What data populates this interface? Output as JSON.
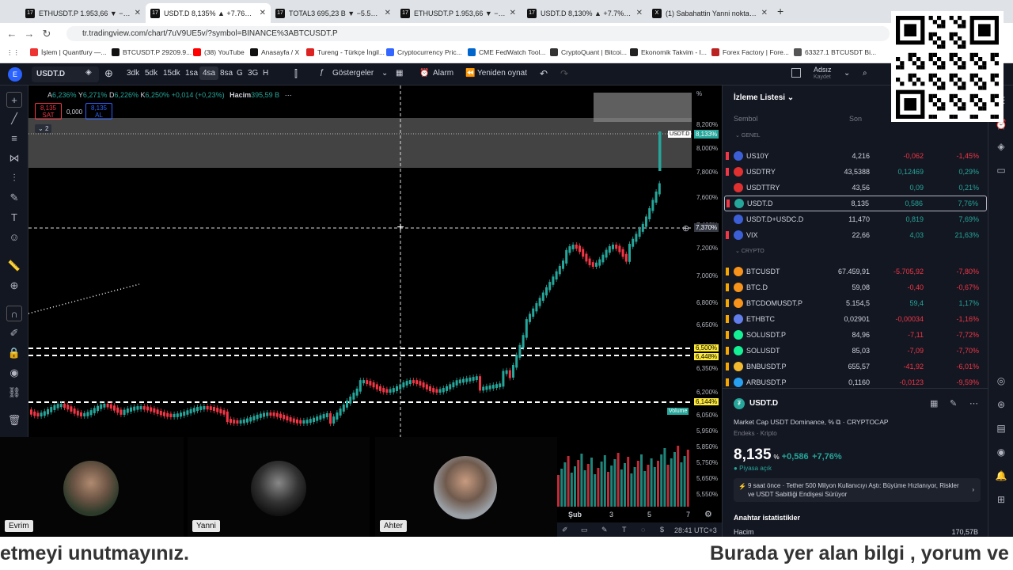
{
  "browser": {
    "tabs": [
      {
        "title": "ETHUSDT.P 1.953,66 ▼ −9.01%"
      },
      {
        "title": "USDT.D 8,135% ▲ +7.76% Adsız"
      },
      {
        "title": "TOTAL3 695,23 B ▼ −5.51% Adsız"
      },
      {
        "title": "ETHUSDT.P 1.953,66 ▼ −9.01%"
      },
      {
        "title": "USDT.D 8,130% ▲ +7.7% Adsız"
      },
      {
        "title": "(1) Sabahattin Yanni nokta Eteh"
      }
    ],
    "url": "tr.tradingview.com/chart/7uV9UE5v/?symbol=BINANCE%3ABTCUSDT.P",
    "bookmarks": [
      "İşlem | Quantfury —...",
      "BTCUSDT.P 29209.9...",
      "(38) YouTube",
      "Anasayfa / X",
      "Tureng - Türkçe İngil...",
      "Cryptocurrency Pric...",
      "CME FedWatch Tool...",
      "CryptoQuant | Bitcoi...",
      "Ekonomik Takvim - I...",
      "Forex Factory | Fore...",
      "63327.1 BTCUSDT Bi..."
    ]
  },
  "toolbar": {
    "symbol": "USDT.D",
    "intervals": [
      "3dk",
      "5dk",
      "15dk",
      "1sa",
      "4sa",
      "8sa",
      "G",
      "3G",
      "H"
    ],
    "active_interval": "4sa",
    "indicators": "Göstergeler",
    "alarm": "Alarm",
    "replay": "Yeniden oynat",
    "layout_name": "Adsız",
    "layout_sub": "Kaydet"
  },
  "legend": {
    "o": "A",
    "o_val": "6,236%",
    "h": "Y",
    "h_val": "6,271%",
    "l": "D",
    "l_val": "6,226%",
    "c": "K",
    "c_val": "6,250%",
    "change": "+0,014 (+0,23%)",
    "vol_label": "Hacim",
    "vol_val": "395,59 B",
    "sell_price": "8,135",
    "sell_label": "SAT",
    "spread": "0,000",
    "buy_price": "8,135",
    "buy_label": "AL",
    "collapse": "2"
  },
  "price_axis": {
    "labels": [
      "8,200%",
      "8,000%",
      "7,800%",
      "7,600%",
      "7,400%",
      "7,200%",
      "7,000%",
      "6,800%",
      "6,650%",
      "6,500%",
      "6,350%",
      "6,200%",
      "6,050%",
      "5,950%",
      "5,850%",
      "5,750%",
      "5,650%",
      "5,550%"
    ],
    "unit": "%",
    "current_symbol": "USDT.D",
    "current_price": "8,133%",
    "crosshair_price": "7,370%",
    "line1": "6,500%",
    "line2": "6,448%",
    "line3": "6,144%",
    "volume_tag": "Volume"
  },
  "date_axis": {
    "labels": [
      "Şub",
      "3",
      "5",
      "7"
    ]
  },
  "bottom_bar": {
    "time": "28:41 UTC+3"
  },
  "watchlist": {
    "title": "İzleme Listesi",
    "col_symbol": "Sembol",
    "col_last": "Son",
    "groups": [
      {
        "name": "GENEL",
        "rows": [
          {
            "sym": "US10Y",
            "last": "4,216",
            "chg": "-0,062",
            "pct": "-1,45%",
            "dir": "neg",
            "color": "#3c5fd6",
            "mark": "#f23645"
          },
          {
            "sym": "USDTRY",
            "last": "43,5388",
            "chg": "0,12469",
            "pct": "0,29%",
            "dir": "pos",
            "color": "#e03030",
            "mark": "#f23645"
          },
          {
            "sym": "USDTTRY",
            "last": "43,56",
            "chg": "0,09",
            "pct": "0,21%",
            "dir": "pos",
            "color": "#e03030",
            "mark": ""
          },
          {
            "sym": "USDT.D",
            "last": "8,135",
            "chg": "0,586",
            "pct": "7,76%",
            "dir": "pos",
            "color": "#26a69a",
            "mark": "#f23645"
          },
          {
            "sym": "USDT.D+USDC.D",
            "last": "11,470",
            "chg": "0,819",
            "pct": "7,69%",
            "dir": "pos",
            "color": "#3c5fd6",
            "mark": ""
          },
          {
            "sym": "VIX",
            "last": "22,66",
            "chg": "4,03",
            "pct": "21,63%",
            "dir": "pos",
            "color": "#3c5fd6",
            "mark": "#f23645"
          }
        ]
      },
      {
        "name": "CRYPTO",
        "rows": [
          {
            "sym": "BTCUSDT",
            "last": "67.459,91",
            "chg": "-5.705,92",
            "pct": "-7,80%",
            "dir": "neg",
            "color": "#f7931a",
            "mark": "#f7a600"
          },
          {
            "sym": "BTC.D",
            "last": "59,08",
            "chg": "-0,40",
            "pct": "-0,67%",
            "dir": "neg",
            "color": "#f7931a",
            "mark": "#f7a600"
          },
          {
            "sym": "BTCDOMUSDT.P",
            "last": "5.154,5",
            "chg": "59,4",
            "pct": "1,17%",
            "dir": "pos",
            "color": "#f7931a",
            "mark": "#f7a600"
          },
          {
            "sym": "ETHBTC",
            "last": "0,02901",
            "chg": "-0,00034",
            "pct": "-1,16%",
            "dir": "neg",
            "color": "#627eea",
            "mark": "#f7a600"
          },
          {
            "sym": "SOLUSDT.P",
            "last": "84,96",
            "chg": "-7,11",
            "pct": "-7,72%",
            "dir": "neg",
            "color": "#14f195",
            "mark": "#f7a600"
          },
          {
            "sym": "SOLUSDT",
            "last": "85,03",
            "chg": "-7,09",
            "pct": "-7,70%",
            "dir": "neg",
            "color": "#14f195",
            "mark": "#f7a600"
          },
          {
            "sym": "BNBUSDT.P",
            "last": "655,57",
            "chg": "-41,92",
            "pct": "-6,01%",
            "dir": "neg",
            "color": "#f3ba2f",
            "mark": "#f7a600"
          },
          {
            "sym": "ARBUSDT.P",
            "last": "0,1160",
            "chg": "-0,0123",
            "pct": "-9,59%",
            "dir": "neg",
            "color": "#28a0f0",
            "mark": "#f7a600"
          }
        ]
      }
    ]
  },
  "details": {
    "symbol": "USDT.D",
    "name": "Market Cap USDT Dominance, %",
    "source": "CRYPTOCAP",
    "category": "Endeks · Kripto",
    "price": "8,135",
    "unit": "%",
    "change": "+0,586",
    "change_pct": "+7,76%",
    "market_status": "Piyasa açık",
    "news": "9 saat önce · Tether 500 Milyon Kullanıcıyı Aştı: Büyüme Hızlanıyor, Riskler ve USDT Sabitliği Endişesi Sürüyor",
    "stats_title": "Anahtar istatistikler",
    "stat_label": "Hacim",
    "stat_value": "170,57B"
  },
  "cams": [
    {
      "name": "Evrim"
    },
    {
      "name": "Yanni"
    },
    {
      "name": "Ahter"
    }
  ],
  "ticker": {
    "left": "etmeyi unutmayınız.",
    "right": "Burada yer alan bilgi , yorum ve"
  },
  "colors": {
    "bg": "#000000",
    "panel": "#131722",
    "up": "#26a69a",
    "down": "#f23645",
    "accent": "#2962ff"
  }
}
